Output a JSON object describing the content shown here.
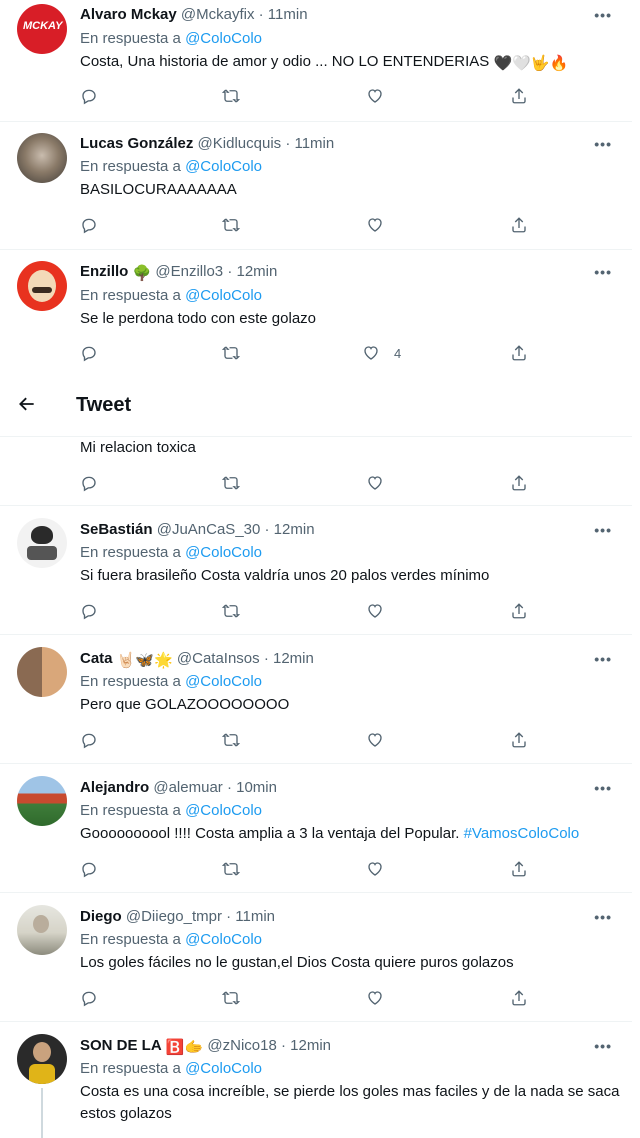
{
  "header": {
    "back_icon": "arrow-left-icon",
    "title": "Tweet"
  },
  "reply_prefix": "En respuesta a",
  "partial_tweet": {
    "text": "Mi relacion toxica"
  },
  "tweets": [
    {
      "name": "Alvaro Mckay",
      "handle": "@Mckayfix",
      "time": "· 11min",
      "mention": "@ColoColo",
      "text": "Costa, Una historia de amor y odio ... NO LO ENTENDERIAS",
      "emojis": "🖤🤍🤟🔥",
      "likes": ""
    },
    {
      "name": "Lucas González",
      "handle": "@Kidlucquis",
      "time": "· 11min",
      "mention": "@ColoColo",
      "text": "BASILOCURAAAAAAA",
      "likes": ""
    },
    {
      "name": "Enzillo",
      "name_emoji": "🌳",
      "handle": "@Enzillo3",
      "time": "· 12min",
      "mention": "@ColoColo",
      "text": "Se le perdona todo con este golazo",
      "likes": "4"
    },
    {
      "name": "SeBastián",
      "handle": "@JuAnCaS_30",
      "time": "· 12min",
      "mention": "@ColoColo",
      "text": "Si fuera brasileño Costa valdría unos 20 palos verdes mínimo",
      "likes": ""
    },
    {
      "name": "Cata",
      "name_emoji": "🤘🏻🦋🌟",
      "handle": "@CataInsos",
      "time": "· 12min",
      "mention": "@ColoColo",
      "text": "Pero que GOLAZOOOOOOOO",
      "likes": ""
    },
    {
      "name": "Alejandro",
      "handle": "@alemuar",
      "time": "· 10min",
      "mention": "@ColoColo",
      "text": "Goooooooool !!!! Costa amplia a 3 la ventaja del Popular.",
      "hashtag": "#VamosColoColo",
      "likes": ""
    },
    {
      "name": "Diego",
      "handle": "@Diiego_tmpr",
      "time": "· 11min",
      "mention": "@ColoColo",
      "text": "Los goles fáciles no le gustan,el Dios Costa quiere puros golazos",
      "likes": ""
    },
    {
      "name": "SON DE LA",
      "name_emoji": "🅱️🫱",
      "handle": "@zNico18",
      "time": "· 12min",
      "mention": "@ColoColo",
      "text": "Costa es una cosa increíble, se pierde los goles mas faciles y de la nada se saca estos golazos",
      "likes": ""
    }
  ],
  "more_label": "•••",
  "colors": {
    "accent": "#1d9bf0",
    "muted": "#536471",
    "text": "#0f1419",
    "divider": "#eff3f4"
  }
}
